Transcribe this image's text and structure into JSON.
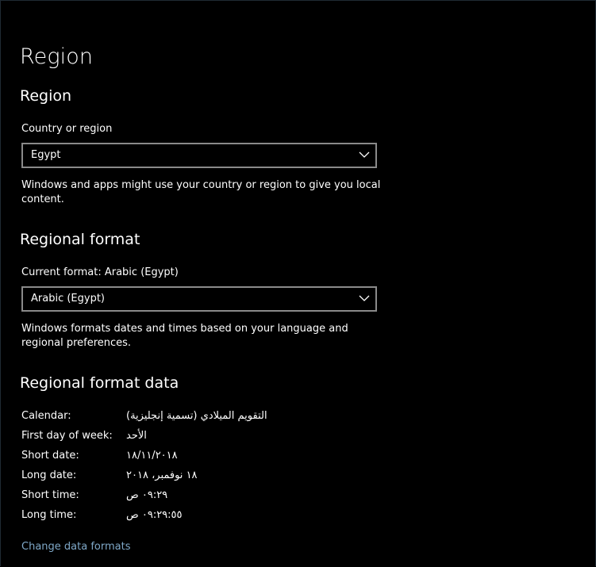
{
  "page": {
    "title": "Region"
  },
  "region_section": {
    "heading": "Region",
    "country_label": "Country or region",
    "country_value": "Egypt",
    "description": "Windows and apps might use your country or region to give you local content."
  },
  "format_section": {
    "heading": "Regional format",
    "current_label": "Current format: Arabic (Egypt)",
    "format_value": "Arabic (Egypt)",
    "description": "Windows formats dates and times based on your language and regional preferences."
  },
  "format_data_section": {
    "heading": "Regional format data",
    "rows": [
      {
        "key": "Calendar:",
        "value": "التقويم الميلادي (تسمية إنجليزية)"
      },
      {
        "key": "First day of week:",
        "value": "الأحد"
      },
      {
        "key": "Short date:",
        "value": "١٨/١١/٢٠١٨"
      },
      {
        "key": "Long date:",
        "value": "١٨ نوفمبر، ٢٠١٨"
      },
      {
        "key": "Short time:",
        "value": "٠٩:٢٩ ص"
      },
      {
        "key": "Long time:",
        "value": "٠٩:٢٩:٥٥ ص"
      }
    ],
    "link_label": "Change data formats"
  },
  "colors": {
    "background": "#000000",
    "text": "#ffffff",
    "combo_border": "#8a8a8a",
    "link": "#7fa8c8"
  },
  "icons": {
    "dropdown": "chevron-down-icon"
  }
}
